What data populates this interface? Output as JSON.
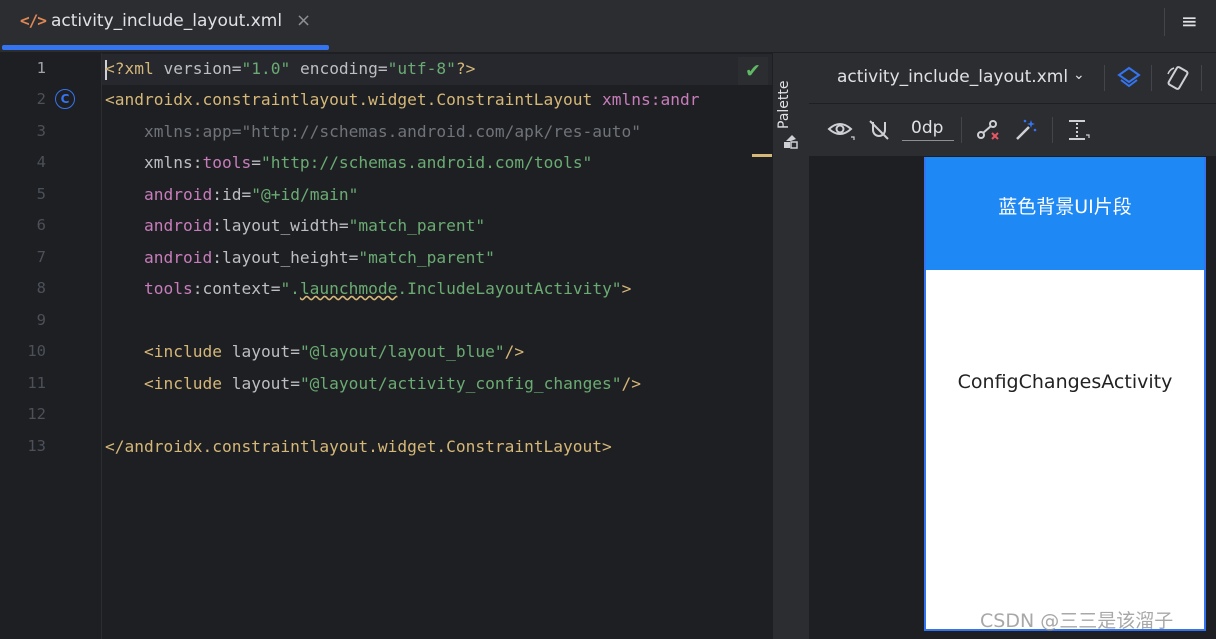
{
  "tab": {
    "icon": "xml-file-icon",
    "icon_text": "</>",
    "title": "activity_include_layout.xml",
    "close": "×"
  },
  "tab_menu": "≡",
  "editor": {
    "line_numbers": [
      "1",
      "2",
      "3",
      "4",
      "5",
      "6",
      "7",
      "8",
      "9",
      "10",
      "11",
      "12",
      "13"
    ],
    "gutter_marker": "C",
    "lines": {
      "l1": {
        "lt": "<",
        "b": "?xml ",
        "attr1": "version",
        "eq1": "=",
        "v1": "\"1.0\"",
        "sp": " ",
        "attr2": "encoding",
        "eq2": "=",
        "v2": "\"utf-8\"",
        "end": "?>"
      },
      "l2": {
        "tag": "<androidx.constraintlayout.widget.ConstraintLayout ",
        "ns": "xmlns:andr"
      },
      "l3": {
        "attr": "xmlns:app=\"http://schemas.android.com/apk/res-auto\""
      },
      "l4": {
        "a": "xmlns:",
        "ns": "tools",
        "eq": "=",
        "v": "\"http://schemas.android.com/tools\""
      },
      "l5": {
        "ns": "android",
        "a": ":id",
        "eq": "=",
        "v": "\"@+id/main\""
      },
      "l6": {
        "ns": "android",
        "a": ":layout_width",
        "eq": "=",
        "v": "\"match_parent\""
      },
      "l7": {
        "ns": "android",
        "a": ":layout_height",
        "eq": "=",
        "v": "\"match_parent\""
      },
      "l8": {
        "ns": "tools",
        "a": ":context",
        "eq": "=",
        "v1": "\".",
        "v2": "launchmode",
        "v3": ".IncludeLayoutActivity\"",
        "end": ">"
      },
      "l10": {
        "tag": "<include ",
        "a": "layout",
        "eq": "=",
        "v": "\"@layout/layout_blue\"",
        "end": "/>"
      },
      "l11": {
        "tag": "<include ",
        "a": "layout",
        "eq": "=",
        "v": "\"@layout/activity_config_changes\"",
        "end": "/>"
      },
      "l13": {
        "tag": "</androidx.constraintlayout.widget.ConstraintLayout>"
      }
    },
    "status_icon": "check-icon",
    "status": "✔"
  },
  "palette": {
    "label": "Palette"
  },
  "design": {
    "file": "activity_include_layout.xml",
    "chevron": "⌄",
    "margin": "0dp",
    "preview": {
      "blue_text": "蓝色背景UI片段",
      "config_text": "ConfigChangesActivity"
    }
  },
  "watermark": "CSDN @三三是该溜子",
  "colors": {
    "accent": "#3574f0",
    "preview_blue": "#1e88f5"
  }
}
